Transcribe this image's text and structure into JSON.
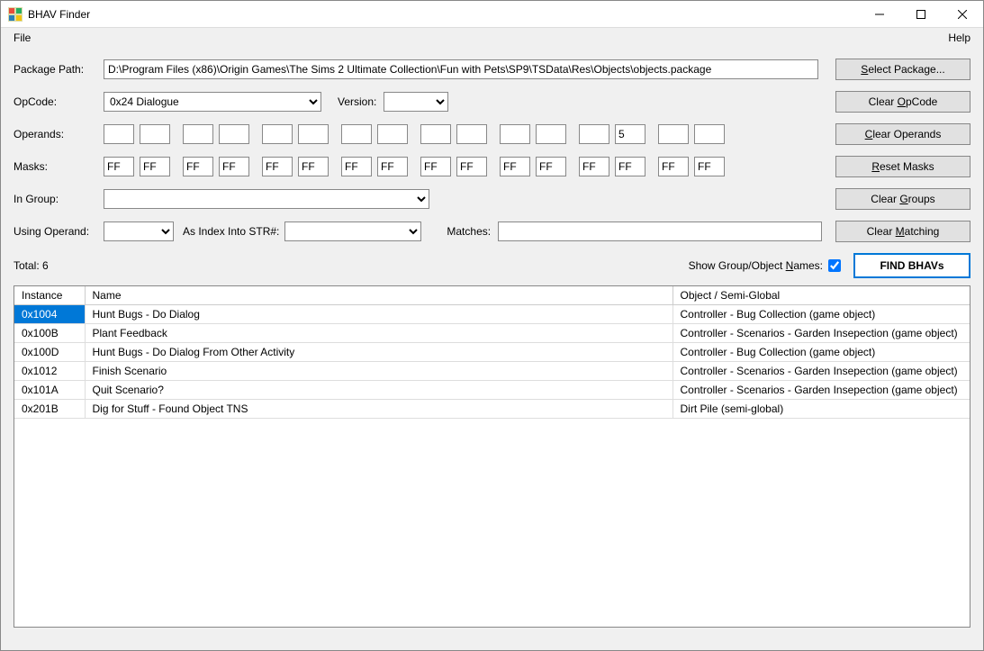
{
  "window": {
    "title": "BHAV Finder"
  },
  "menu": {
    "file": "File",
    "help": "Help"
  },
  "labels": {
    "package_path": "Package Path:",
    "opcode": "OpCode:",
    "version": "Version:",
    "operands": "Operands:",
    "masks": "Masks:",
    "in_group": "In Group:",
    "using_operand": "Using Operand:",
    "as_index": "As Index Into STR#:",
    "matches": "Matches:",
    "show_names": "Show Group/Object Names:",
    "total_prefix": "Total: ",
    "total_count": "6"
  },
  "buttons": {
    "select_package": "Select Package...",
    "clear_opcode": "Clear OpCode",
    "clear_operands": "Clear Operands",
    "reset_masks": "Reset Masks",
    "clear_groups": "Clear Groups",
    "clear_matching": "Clear Matching",
    "find_bhavs": "FIND BHAVs"
  },
  "fields": {
    "package_path": "D:\\Program Files (x86)\\Origin Games\\The Sims 2 Ultimate Collection\\Fun with Pets\\SP9\\TSData\\Res\\Objects\\objects.package",
    "opcode": "0x24 Dialogue",
    "version": "",
    "operands": [
      "",
      "",
      "",
      "",
      "",
      "",
      "",
      "",
      "",
      "",
      "",
      "",
      "",
      "5",
      "",
      ""
    ],
    "masks": [
      "FF",
      "FF",
      "FF",
      "FF",
      "FF",
      "FF",
      "FF",
      "FF",
      "FF",
      "FF",
      "FF",
      "FF",
      "FF",
      "FF",
      "FF",
      "FF"
    ],
    "in_group": "",
    "using_operand": "",
    "as_index": "",
    "matches": "",
    "show_names_checked": true
  },
  "table": {
    "headers": {
      "instance": "Instance",
      "name": "Name",
      "object": "Object / Semi-Global"
    },
    "rows": [
      {
        "instance": "0x1004",
        "name": "Hunt Bugs - Do Dialog",
        "object": "Controller - Bug Collection (game object)",
        "selected": true
      },
      {
        "instance": "0x100B",
        "name": "Plant Feedback",
        "object": "Controller - Scenarios - Garden Insepection (game object)",
        "selected": false
      },
      {
        "instance": "0x100D",
        "name": "Hunt Bugs - Do Dialog From Other Activity",
        "object": "Controller - Bug Collection (game object)",
        "selected": false
      },
      {
        "instance": "0x1012",
        "name": "Finish Scenario",
        "object": "Controller - Scenarios - Garden Insepection (game object)",
        "selected": false
      },
      {
        "instance": "0x101A",
        "name": "Quit Scenario?",
        "object": "Controller - Scenarios - Garden Insepection (game object)",
        "selected": false
      },
      {
        "instance": "0x201B",
        "name": "Dig for Stuff - Found Object TNS",
        "object": "Dirt Pile (semi-global)",
        "selected": false
      }
    ]
  }
}
